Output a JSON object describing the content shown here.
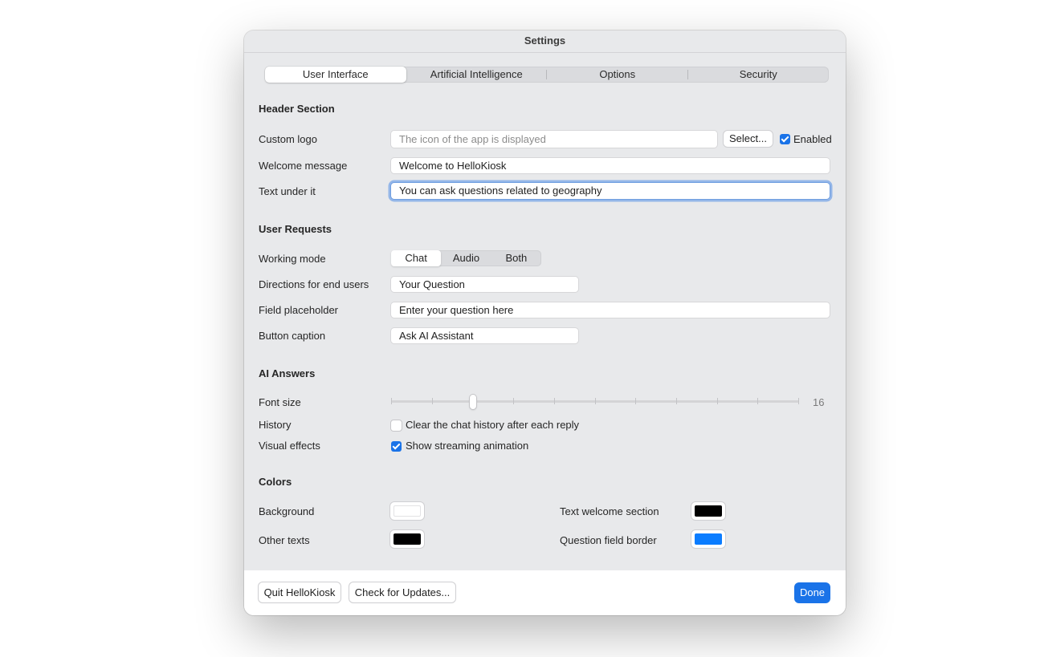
{
  "window": {
    "title": "Settings"
  },
  "tabs": [
    {
      "label": "User Interface"
    },
    {
      "label": "Artificial Intelligence"
    },
    {
      "label": "Options"
    },
    {
      "label": "Security"
    }
  ],
  "header_section": {
    "title": "Header Section",
    "custom_logo": {
      "label": "Custom logo",
      "placeholder": "The icon of the app is displayed",
      "select_label": "Select...",
      "enabled_label": "Enabled",
      "enabled": true
    },
    "welcome_message": {
      "label": "Welcome message",
      "value": "Welcome to HelloKiosk"
    },
    "text_under": {
      "label": "Text under it",
      "value": "You can ask questions related to geography"
    }
  },
  "user_requests": {
    "title": "User Requests",
    "working_mode": {
      "label": "Working mode",
      "options": [
        "Chat",
        "Audio",
        "Both"
      ],
      "selected": "Chat"
    },
    "directions": {
      "label": "Directions for end users",
      "value": "Your Question"
    },
    "field_placeholder": {
      "label": "Field placeholder",
      "value": "Enter your question here"
    },
    "button_caption": {
      "label": "Button caption",
      "value": "Ask AI Assistant"
    }
  },
  "ai_answers": {
    "title": "AI Answers",
    "font_size": {
      "label": "Font size",
      "value": "16",
      "position_fraction": 0.2
    },
    "history": {
      "label": "History",
      "checkbox_label": "Clear the chat history after each reply",
      "checked": false
    },
    "visual_effects": {
      "label": "Visual effects",
      "checkbox_label": "Show streaming animation",
      "checked": true
    }
  },
  "colors": {
    "title": "Colors",
    "background": {
      "label": "Background",
      "color": "#ffffff"
    },
    "text_welcome": {
      "label": "Text welcome section",
      "color": "#000000"
    },
    "other_texts": {
      "label": "Other texts",
      "color": "#000000"
    },
    "question_border": {
      "label": "Question field border",
      "color": "#0a7cff"
    }
  },
  "footer": {
    "quit_label": "Quit HelloKiosk",
    "updates_label": "Check for Updates...",
    "done_label": "Done"
  },
  "accent_color": "#1a73e8"
}
